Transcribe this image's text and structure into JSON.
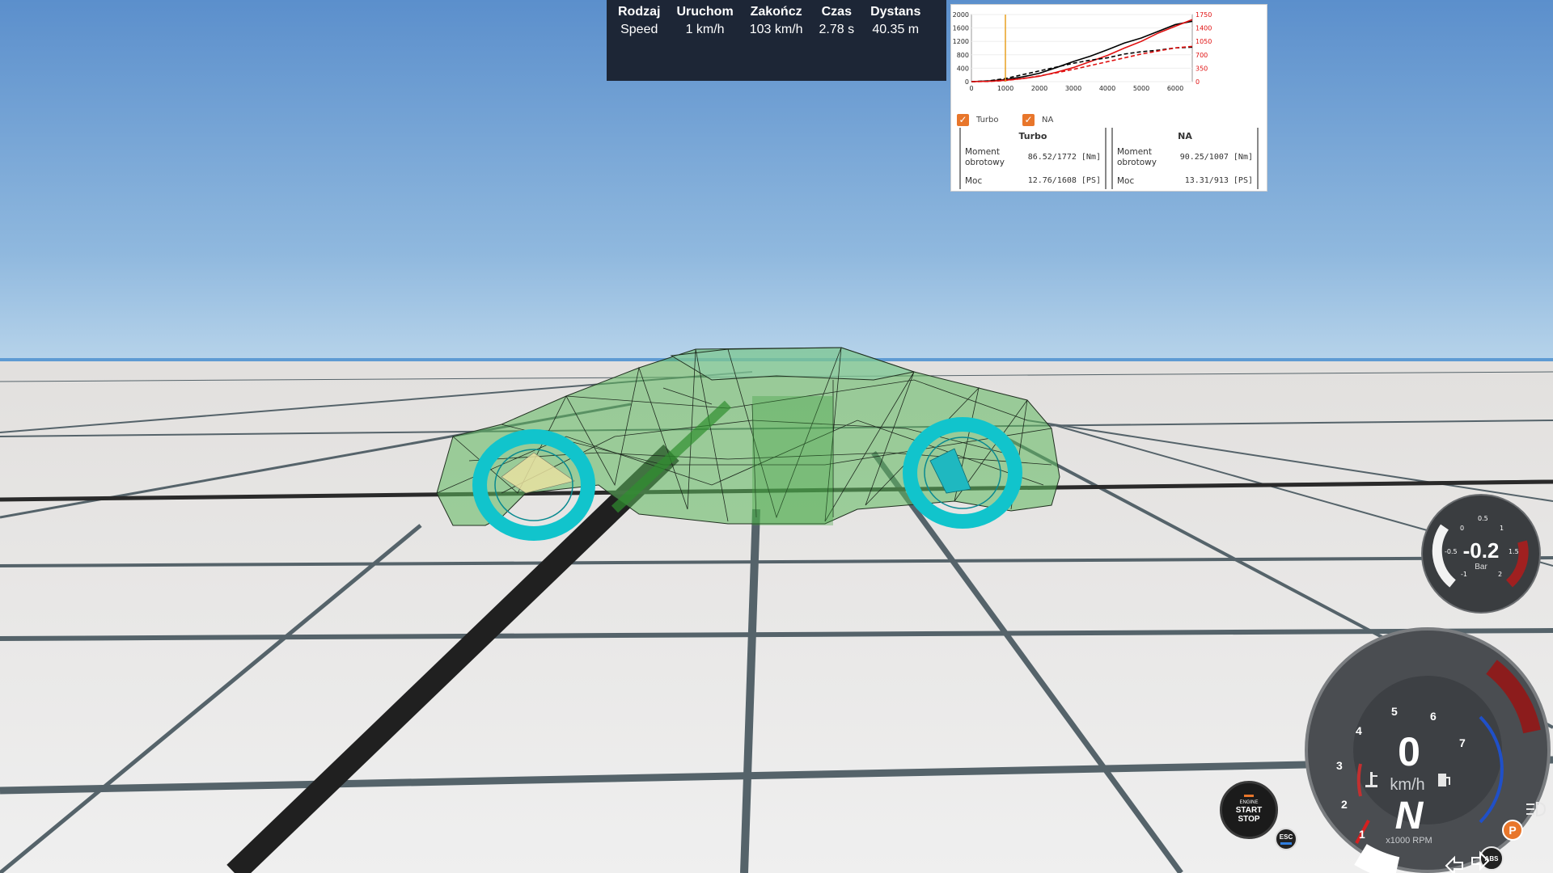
{
  "run_panel": {
    "headers": [
      "Rodzaj",
      "Uruchom",
      "Zakończ",
      "Czas",
      "Dystans"
    ],
    "row": [
      "Speed",
      "1 km/h",
      "103 km/h",
      "2.78 s",
      "40.35 m"
    ]
  },
  "dyno": {
    "legend": {
      "turbo": "Turbo",
      "na": "NA"
    },
    "turbo": {
      "header": "Turbo",
      "torque_label": "Moment obrotowy",
      "torque_value": "86.52/1772 [Nm]",
      "power_label": "Moc",
      "power_value": "12.76/1608 [PS]"
    },
    "na": {
      "header": "NA",
      "torque_label": "Moment obrotowy",
      "torque_value": "90.25/1007 [Nm]",
      "power_label": "Moc",
      "power_value": "13.31/913  [PS]"
    }
  },
  "chart_data": {
    "type": "line",
    "x_ticks": [
      0,
      1000,
      2000,
      3000,
      4000,
      5000,
      6000
    ],
    "y_left_ticks": [
      0,
      400,
      800,
      1200,
      1600,
      2000
    ],
    "y_right_ticks": [
      0,
      350,
      700,
      1050,
      1400,
      1750
    ],
    "xlim": [
      0,
      6500
    ],
    "ylim_left": [
      0,
      2000
    ],
    "ylim_right": [
      0,
      1750
    ],
    "cursor_rpm": 1000,
    "colors": {
      "turbo": "#000000",
      "na": "#e01010",
      "cursor": "#e8a020"
    },
    "series": [
      {
        "line": "solid",
        "color": "turbo",
        "axis": "left",
        "x": [
          0,
          500,
          1000,
          1500,
          2000,
          2500,
          3000,
          3500,
          4000,
          4500,
          5000,
          5500,
          6000,
          6500
        ],
        "y": [
          0,
          20,
          60,
          140,
          250,
          420,
          600,
          760,
          950,
          1150,
          1300,
          1500,
          1700,
          1800
        ]
      },
      {
        "line": "solid",
        "color": "na",
        "axis": "left",
        "x": [
          0,
          500,
          1000,
          1500,
          2000,
          2500,
          3000,
          3500,
          4000,
          4500,
          5000,
          5500,
          6000,
          6500
        ],
        "y": [
          0,
          10,
          40,
          90,
          160,
          280,
          420,
          600,
          780,
          1000,
          1200,
          1450,
          1650,
          1850
        ]
      },
      {
        "line": "dashed",
        "color": "turbo",
        "axis": "right",
        "x": [
          0,
          500,
          1000,
          1500,
          2000,
          2500,
          3000,
          3500,
          4000,
          4500,
          5000,
          5500,
          6000,
          6500
        ],
        "y": [
          0,
          20,
          80,
          180,
          280,
          380,
          480,
          560,
          620,
          720,
          780,
          820,
          880,
          900
        ]
      },
      {
        "line": "dashed",
        "color": "na",
        "axis": "right",
        "x": [
          0,
          500,
          1000,
          1500,
          2000,
          2500,
          3000,
          3500,
          4000,
          4500,
          5000,
          5500,
          6000,
          6500
        ],
        "y": [
          0,
          5,
          30,
          80,
          150,
          230,
          320,
          420,
          520,
          620,
          720,
          800,
          880,
          920
        ]
      }
    ]
  },
  "boost_gauge": {
    "value": "-0.2",
    "unit": "Bar",
    "ticks": [
      "-1",
      "-0.5",
      "0",
      "0.5",
      "1",
      "1.5",
      "2"
    ]
  },
  "dash": {
    "speed": "0",
    "speed_unit": "km/h",
    "gear": "N",
    "rpm_caption": "x1000 RPM",
    "rpm_ticks": [
      "1",
      "2",
      "3",
      "4",
      "5",
      "6",
      "7"
    ],
    "indicators": {
      "parking": "P",
      "abs": "ABS"
    }
  },
  "start_stop": {
    "line1": "ENGINE",
    "line2": "START",
    "line3": "STOP"
  },
  "esc": {
    "label": "ESC"
  }
}
